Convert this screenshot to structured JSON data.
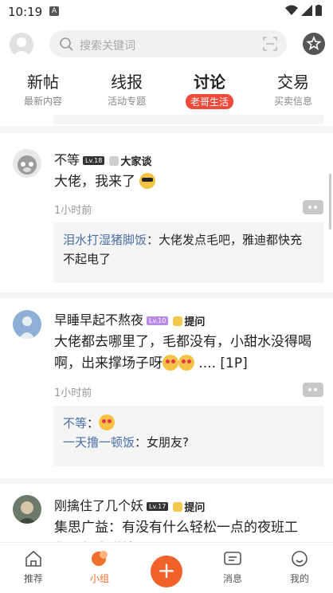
{
  "status": {
    "time": "10:19",
    "badge": "A"
  },
  "search": {
    "placeholder": "搜索关键词"
  },
  "tabs": [
    {
      "title": "新帖",
      "sub": "最新内容"
    },
    {
      "title": "线报",
      "sub": "活动专题"
    },
    {
      "title": "讨论",
      "sub": "老哥生活"
    },
    {
      "title": "交易",
      "sub": "买卖信息"
    }
  ],
  "posts": [
    {
      "user": "不等",
      "level": "Lv.18",
      "tag": "大家谈",
      "content": "大佬，我来了",
      "time": "1小时前",
      "comments": [
        {
          "name": "泪水打湿猪脚饭",
          "text": "：大佬发点毛吧，雅迪都快充不起电了"
        }
      ]
    },
    {
      "user": "早睡早起不熬夜",
      "level": "Lv.10",
      "tag": "提问",
      "content_a": "大佬都去哪里了，毛都没有，小甜水没得喝啊，出来撑场子呀",
      "content_b": " .... [1P]",
      "time": "1小时前",
      "comments": [
        {
          "name": "不等",
          "text": "："
        },
        {
          "name": "一天撸一顿饭",
          "text": "：女朋友?"
        }
      ]
    },
    {
      "user": "刚擒住了几个妖",
      "level": "Lv.17",
      "tag": "提问",
      "content": "集思广益：有没有什么轻松一点的夜班工作，保底赚钱？"
    }
  ],
  "nav": [
    {
      "label": "推荐",
      "icon": "home-icon"
    },
    {
      "label": "小组",
      "icon": "group-icon"
    },
    {
      "label": "消息",
      "icon": "message-icon"
    },
    {
      "label": "我的",
      "icon": "profile-icon"
    }
  ],
  "colors": {
    "accent": "#f0622a",
    "badge": "#f04a3a",
    "comment_name": "#4a6fa5"
  }
}
